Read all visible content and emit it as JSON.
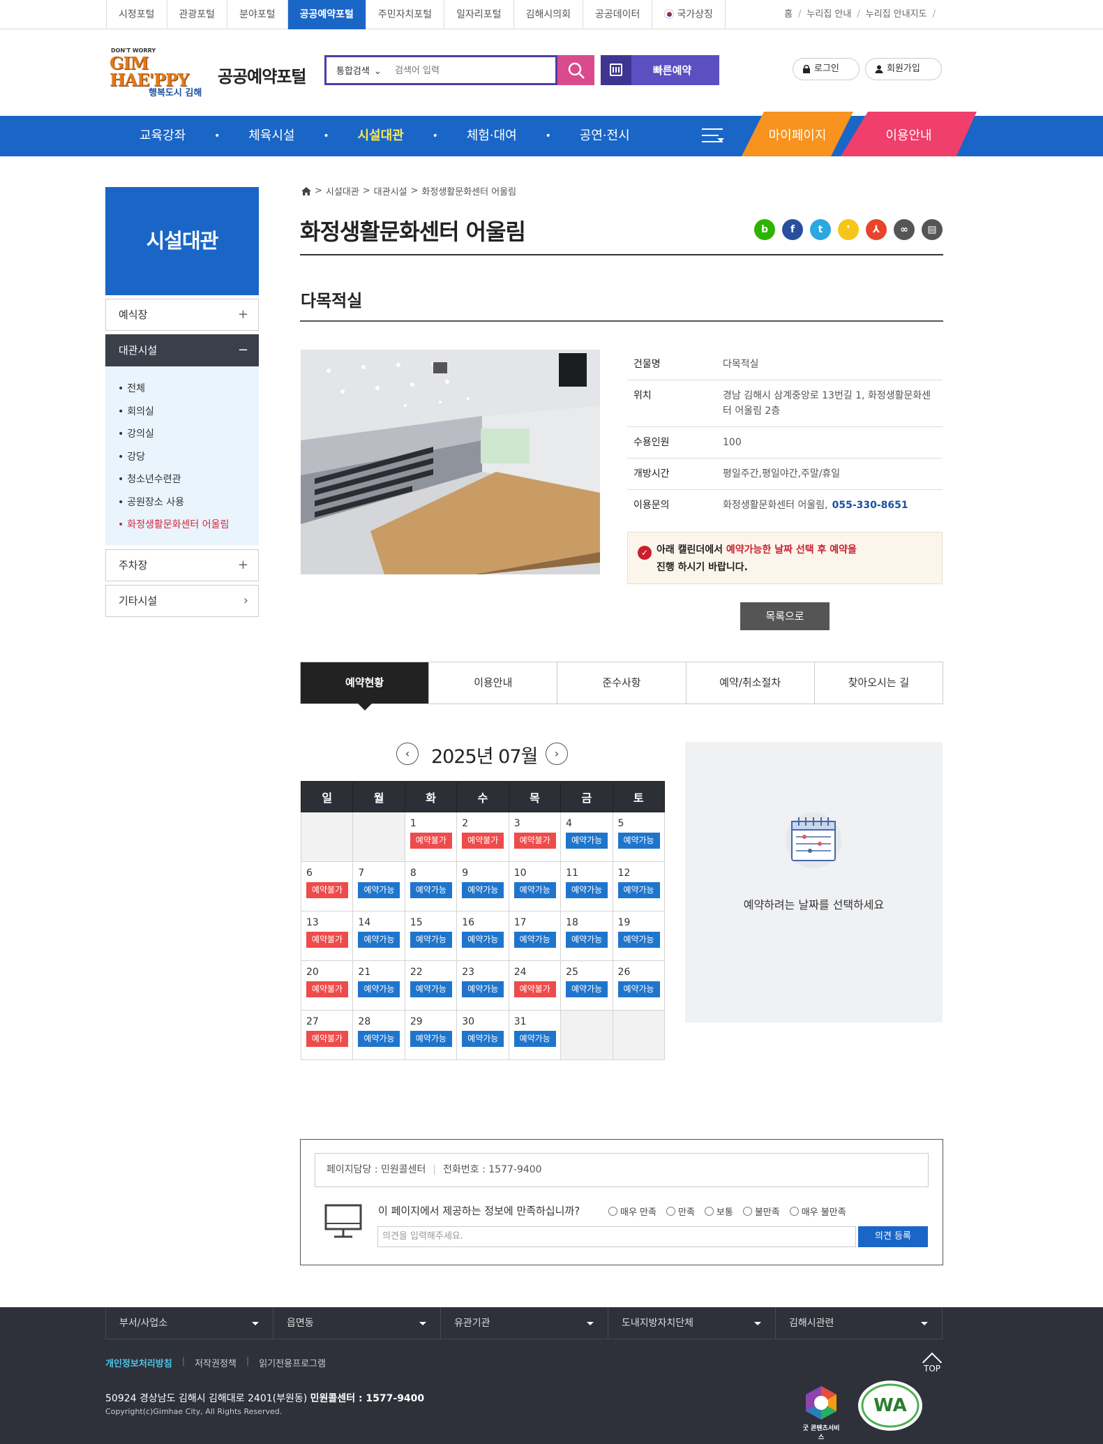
{
  "topbar": {
    "portals": [
      "시정포털",
      "관광포털",
      "분야포털",
      "공공예약포털",
      "주민자치포털",
      "일자리포털",
      "김해시의회",
      "공공데이터",
      "국가상징"
    ],
    "active_portal": 3,
    "util_links": [
      "홈",
      "누리집 안내",
      "누리집 안내지도"
    ]
  },
  "header": {
    "logo": {
      "line1": "DON'T WORRY",
      "line2": "GIM",
      "line3": "HAE'PPY",
      "line4": "행복도시 김해"
    },
    "site_title": "공공예약포털",
    "search": {
      "select_label": "통합검색",
      "placeholder": "검색어 입력"
    },
    "quick_reserve": "빠른예약",
    "login": "로그인",
    "join": "회원가입"
  },
  "gnb": {
    "items": [
      "교육강좌",
      "체육시설",
      "시설대관",
      "체험·대여",
      "공연·전시"
    ],
    "active": 2,
    "mypage": "마이페이지",
    "guide": "이용안내"
  },
  "sidebar": {
    "title": "시설대관",
    "menu": [
      {
        "label": "예식장",
        "sign": "+"
      },
      {
        "label": "대관시설",
        "sign": "−"
      },
      {
        "label": "주차장",
        "sign": "+"
      },
      {
        "label": "기타시설",
        "sign": "›"
      }
    ],
    "submenu": [
      "전체",
      "회의실",
      "강의실",
      "강당",
      "청소년수련관",
      "공원장소 사용",
      "화정생활문화센터 어울림"
    ],
    "active_sub": 6
  },
  "content": {
    "breadcrumb": [
      "시설대관",
      "대관시설",
      "화정생활문화센터 어울림"
    ],
    "title": "화정생활문화센터 어울림",
    "share_icons": [
      {
        "name": "blog",
        "glyph": "b",
        "color": "#2db400"
      },
      {
        "name": "facebook",
        "glyph": "f",
        "color": "#2a4f9c"
      },
      {
        "name": "twitter",
        "glyph": "t",
        "color": "#2ca7e0"
      },
      {
        "name": "kakaostory",
        "glyph": "❜",
        "color": "#f5c518"
      },
      {
        "name": "pdf",
        "glyph": "⅄",
        "color": "#e8442b"
      },
      {
        "name": "link",
        "glyph": "∞",
        "color": "#555"
      },
      {
        "name": "print",
        "glyph": "▤",
        "color": "#555"
      }
    ],
    "sub_title": "다목적실",
    "info": [
      {
        "key": "건물명",
        "value": "다목적실"
      },
      {
        "key": "위치",
        "value": "경남 김해시 삼계중앙로 13번길 1, 화정생활문화센터 어울림 2층"
      },
      {
        "key": "수용인원",
        "value": "100"
      },
      {
        "key": "개방시간",
        "value": "평일주간,평일야간,주말/휴일"
      },
      {
        "key": "이용문의",
        "value": "화정생활문화센터 어울림,",
        "phone": "055-330-8651"
      }
    ],
    "notice": {
      "pre": "아래 캘린더에서 ",
      "highlight": "예약가능한 날짜 선택 후 예약을",
      "post": "진행 하시기 바랍니다."
    },
    "list_button": "목록으로"
  },
  "tabs": [
    "예약현황",
    "이용안내",
    "준수사항",
    "예약/취소절차",
    "찾아오시는 길"
  ],
  "active_tab": 0,
  "calendar": {
    "month_label": "2025년 07월",
    "weekdays": [
      "일",
      "월",
      "화",
      "수",
      "목",
      "금",
      "토"
    ],
    "status_labels": {
      "ok": "예약가능",
      "no": "예약불가"
    },
    "weeks": [
      [
        null,
        null,
        {
          "d": "1",
          "s": "no"
        },
        {
          "d": "2",
          "s": "no"
        },
        {
          "d": "3",
          "s": "no"
        },
        {
          "d": "4",
          "s": "ok"
        },
        {
          "d": "5",
          "s": "ok"
        }
      ],
      [
        {
          "d": "6",
          "s": "no"
        },
        {
          "d": "7",
          "s": "ok"
        },
        {
          "d": "8",
          "s": "ok"
        },
        {
          "d": "9",
          "s": "ok"
        },
        {
          "d": "10",
          "s": "ok"
        },
        {
          "d": "11",
          "s": "ok"
        },
        {
          "d": "12",
          "s": "ok"
        }
      ],
      [
        {
          "d": "13",
          "s": "no"
        },
        {
          "d": "14",
          "s": "ok"
        },
        {
          "d": "15",
          "s": "ok"
        },
        {
          "d": "16",
          "s": "ok"
        },
        {
          "d": "17",
          "s": "ok"
        },
        {
          "d": "18",
          "s": "ok"
        },
        {
          "d": "19",
          "s": "ok"
        }
      ],
      [
        {
          "d": "20",
          "s": "no"
        },
        {
          "d": "21",
          "s": "ok"
        },
        {
          "d": "22",
          "s": "ok"
        },
        {
          "d": "23",
          "s": "ok"
        },
        {
          "d": "24",
          "s": "no"
        },
        {
          "d": "25",
          "s": "ok"
        },
        {
          "d": "26",
          "s": "ok"
        }
      ],
      [
        {
          "d": "27",
          "s": "no"
        },
        {
          "d": "28",
          "s": "ok"
        },
        {
          "d": "29",
          "s": "ok"
        },
        {
          "d": "30",
          "s": "ok"
        },
        {
          "d": "31",
          "s": "ok"
        },
        null,
        null
      ]
    ],
    "panel_text": "예약하려는 날짜를 선택하세요"
  },
  "feedback": {
    "manager_label": "페이지담당 : 민원콜센터",
    "phone_label": "전화번호 :  1577-9400",
    "question": "이 페이지에서 제공하는 정보에 만족하십니까?",
    "options": [
      "매우 만족",
      "만족",
      "보통",
      "불만족",
      "매우 불만족"
    ],
    "input_placeholder": "의견을 입력해주세요.",
    "submit": "의견 등록"
  },
  "footer": {
    "selects": [
      "부서/사업소",
      "읍면동",
      "유관기관",
      "도내지방자치단체",
      "김해시관련"
    ],
    "links": [
      "개인정보처리방침",
      "저작권정책",
      "읽기전용프로그램"
    ],
    "address": "50924 경상남도 김해시 김해대로 2401(부원동)",
    "callcenter": "민원콜센터 : 1577-9400",
    "copyright": "Copyright(c)Gimhae City, All Rights Reserved.",
    "top_label": "TOP",
    "good_content_label": "굿 콘텐츠서비스"
  }
}
